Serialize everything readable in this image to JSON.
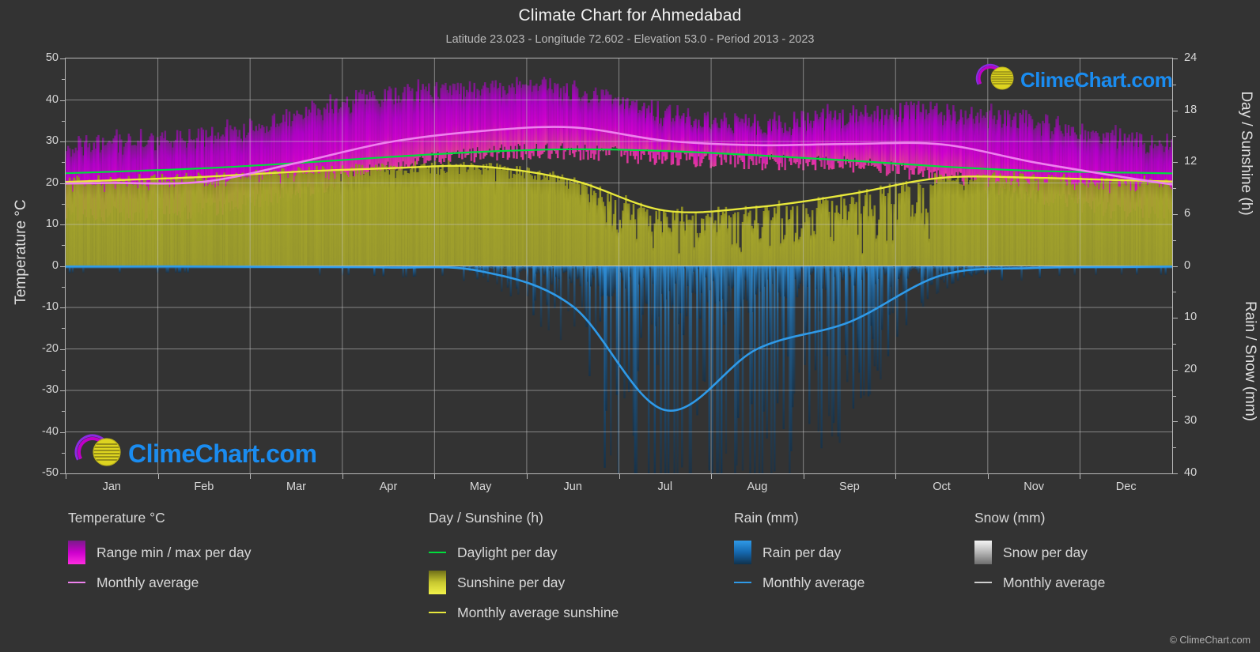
{
  "header": {
    "title": "Climate Chart for Ahmedabad",
    "subtitle": "Latitude 23.023 - Longitude 72.602 - Elevation 53.0 - Period 2013 - 2023"
  },
  "axes": {
    "left_title": "Temperature °C",
    "right_title_top": "Day / Sunshine (h)",
    "right_title_bottom": "Rain / Snow (mm)",
    "left_ticks": [
      "50",
      "40",
      "30",
      "20",
      "10",
      "0",
      "-10",
      "-20",
      "-30",
      "-40",
      "-50"
    ],
    "right_ticks_top": [
      "24",
      "18",
      "12",
      "6",
      "0"
    ],
    "right_ticks_bottom": [
      "10",
      "20",
      "30",
      "40"
    ],
    "x_ticks": [
      "Jan",
      "Feb",
      "Mar",
      "Apr",
      "May",
      "Jun",
      "Jul",
      "Aug",
      "Sep",
      "Oct",
      "Nov",
      "Dec"
    ]
  },
  "legend": {
    "groups": [
      {
        "title": "Temperature °C",
        "items": [
          {
            "label": "Range min / max per day",
            "style": "swatch",
            "color": "#cc00cc"
          },
          {
            "label": "Monthly average",
            "style": "line",
            "color": "#ee82ee"
          }
        ]
      },
      {
        "title": "Day / Sunshine (h)",
        "items": [
          {
            "label": "Daylight per day",
            "style": "line",
            "color": "#00dd3c"
          },
          {
            "label": "Sunshine per day",
            "style": "swatch",
            "color": "#e8e83c"
          },
          {
            "label": "Monthly average sunshine",
            "style": "line",
            "color": "#e8e83c"
          }
        ]
      },
      {
        "title": "Rain (mm)",
        "items": [
          {
            "label": "Rain per day",
            "style": "swatch",
            "color": "#1a8cf0"
          },
          {
            "label": "Monthly average",
            "style": "line",
            "color": "#2f9ae8"
          }
        ]
      },
      {
        "title": "Snow (mm)",
        "items": [
          {
            "label": "Snow per day",
            "style": "swatch",
            "color": "#e8e8e8"
          },
          {
            "label": "Monthly average",
            "style": "line",
            "color": "#cfcfcf"
          }
        ]
      }
    ]
  },
  "branding": {
    "logo_text": "ClimeChart.com",
    "copyright": "© ClimeChart.com"
  },
  "chart_data": {
    "type": "area",
    "title": "Climate Chart for Ahmedabad",
    "subtitle": "Latitude 23.023 - Longitude 72.602 - Elevation 53.0 - Period 2013 - 2023",
    "xlabel": "",
    "ylabel": "Temperature °C",
    "ylim": [
      -50,
      50
    ],
    "y2lim_day_sunshine": [
      0,
      24
    ],
    "y2lim_rain_snow": [
      0,
      40
    ],
    "grid": true,
    "legend_position": "below",
    "categories": [
      "Jan",
      "Feb",
      "Mar",
      "Apr",
      "May",
      "Jun",
      "Jul",
      "Aug",
      "Sep",
      "Oct",
      "Nov",
      "Dec"
    ],
    "series": [
      {
        "name": "Temperature monthly average (°C)",
        "units": "°C",
        "color": "#ee82ee",
        "values": [
          20.0,
          20.3,
          24.8,
          29.8,
          32.5,
          33.4,
          30.2,
          29.1,
          29.4,
          29.3,
          25.0,
          21.3
        ]
      },
      {
        "name": "Temperature daily max (band top, °C)",
        "units": "°C",
        "color": "#cc00cc",
        "values": [
          29.5,
          31.0,
          36.5,
          41.0,
          43.0,
          42.5,
          36.5,
          34.5,
          36.0,
          37.0,
          34.5,
          30.5
        ]
      },
      {
        "name": "Temperature daily min (band bottom, °C)",
        "units": "°C",
        "color": "#cc00cc",
        "values": [
          12.5,
          13.5,
          18.0,
          23.5,
          27.0,
          27.5,
          26.0,
          25.0,
          24.5,
          21.5,
          17.0,
          13.0
        ]
      },
      {
        "name": "Daylight per day (h)",
        "units": "h",
        "color": "#00dd3c",
        "values": [
          10.9,
          11.3,
          11.9,
          12.6,
          13.2,
          13.5,
          13.3,
          12.8,
          12.2,
          11.5,
          11.0,
          10.8
        ]
      },
      {
        "name": "Monthly average sunshine (h)",
        "units": "h",
        "color": "#e8e83c",
        "values": [
          9.9,
          10.3,
          10.9,
          11.3,
          11.5,
          9.9,
          6.4,
          6.8,
          8.3,
          10.2,
          10.2,
          9.9
        ]
      },
      {
        "name": "Rain monthly average (mm)",
        "units": "mm",
        "color": "#2f9ae8",
        "values": [
          0.1,
          0.1,
          0.2,
          0.3,
          1.0,
          7.8,
          27.8,
          16.0,
          10.8,
          1.8,
          0.4,
          0.2
        ]
      },
      {
        "name": "Snow monthly average (mm)",
        "units": "mm",
        "color": "#cfcfcf",
        "values": [
          0,
          0,
          0,
          0,
          0,
          0,
          0,
          0,
          0,
          0,
          0,
          0
        ]
      }
    ]
  }
}
